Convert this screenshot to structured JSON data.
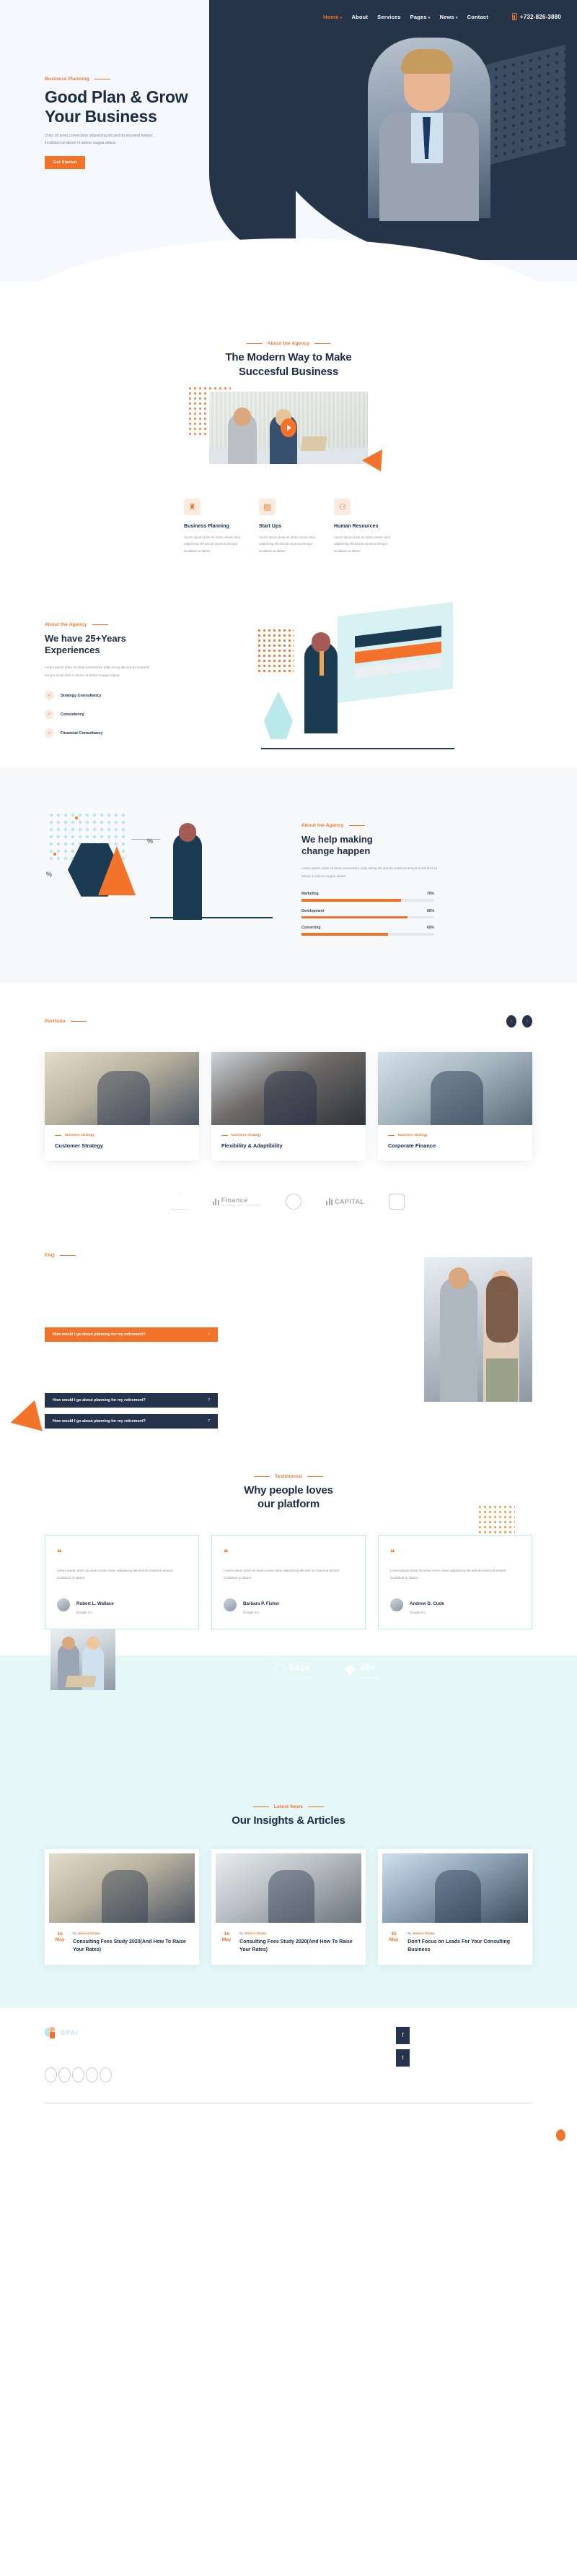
{
  "nav": {
    "items": [
      {
        "label": "Home",
        "caret": true,
        "active": true
      },
      {
        "label": "About",
        "caret": false,
        "active": false
      },
      {
        "label": "Services",
        "caret": false,
        "active": false
      },
      {
        "label": "Pages",
        "caret": true,
        "active": false
      },
      {
        "label": "News",
        "caret": true,
        "active": false
      },
      {
        "label": "Contact",
        "caret": false,
        "active": false
      }
    ],
    "phone": "+732-826-3880"
  },
  "hero": {
    "eyebrow": "Business Planning",
    "title_line1": "Good Plan & Grow",
    "title_line2": "Your Business",
    "description": "Dolor sit amet,consectetur adipisicing elit,sed do eiusmod tempor incididunt ut labore et dolore magna aliqua.",
    "cta": "Get Started"
  },
  "about": {
    "eyebrow": "About the Agency",
    "title_line1": "The Modern Way to Make",
    "title_line2": "Succesful Business",
    "play_label": "play-video"
  },
  "services": [
    {
      "icon": "chess-rook-icon",
      "title": "Business Planning",
      "desc": "Vorem ipsum dolor sit amet,consec tetur adipisicing elit,sed do eiusmod tempor incididunt ut labore"
    },
    {
      "icon": "presentation-chart-icon",
      "title": "Start Ups",
      "desc": "Vorem ipsum dolor sit amet,consec tetur adipisicing elit,sed do eiusmod tempor incididunt ut labore"
    },
    {
      "icon": "people-group-icon",
      "title": "Human Resources",
      "desc": "Vorem ipsum dolor sit amet,consec tetur adipisicing elit,sed do eiusmod tempor incididunt ut labore"
    }
  ],
  "experience": {
    "eyebrow": "About the Agency",
    "title_line1": "We have 25+Years",
    "title_line2": "Experiences",
    "desc": "Lorem ipsum dolor sit amet,consectetur adipi sicing elit,sed do eiusmod tempor incidi dunt ut labore et dolore magna aliqua.",
    "checks": [
      {
        "label": "Strategy Consultancy"
      },
      {
        "label": "Consistency"
      },
      {
        "label": "Financial Consultancy"
      }
    ]
  },
  "change": {
    "eyebrow": "About the Agency",
    "title_line1": "We help making",
    "title_line2": "change happen",
    "desc": "Lorem ipsum dolor sit amet,consectetur adipi sicing elit,sed do eiusmod tempor incidi dunt ut labore et dolore magna aliqua.",
    "pct_badge_1": "%",
    "pct_badge_2": "%",
    "skills": [
      {
        "label": "Marketing",
        "value": 75,
        "value_text": "75%"
      },
      {
        "label": "Development",
        "value": 80,
        "value_text": "80%"
      },
      {
        "label": "Converting",
        "value": 65,
        "value_text": "65%"
      }
    ]
  },
  "portfolio": {
    "eyebrow": "Portfolio",
    "prev": "‹",
    "next": "›",
    "items": [
      {
        "tag": "business strategy",
        "title": "Customer Strategy"
      },
      {
        "tag": "business strategy",
        "title": "Flexibility & Adaptibility"
      },
      {
        "tag": "business strategy",
        "title": "Corporate Finance"
      }
    ]
  },
  "brands": [
    {
      "name": "",
      "sub": ""
    },
    {
      "name": "Finance",
      "sub": "strategy and planning"
    },
    {
      "name": "",
      "sub": ""
    },
    {
      "name": "CAPITAL",
      "sub": ""
    },
    {
      "name": "",
      "sub": ""
    }
  ],
  "faq": {
    "eyebrow": "FAQ",
    "items": [
      {
        "question": "How would I go about planning for my retirement?",
        "state": "open",
        "mark": "?"
      },
      {
        "question": "How would I go about planning for my retirement?",
        "state": "closed",
        "mark": "?"
      },
      {
        "question": "How would I go about planning for my retirement?",
        "state": "closed",
        "mark": "?"
      }
    ]
  },
  "testimonial": {
    "eyebrow": "Testimonial",
    "title_line1": "Why people loves",
    "title_line2": "our platform",
    "items": [
      {
        "quote": "❝",
        "text": "Lorem ipsum dolor sit amet,conse ctetur adipisicing elit,sed do eiusmod tempor incididunt ut labore",
        "name": "Robert L. Wallace",
        "role": "Doogle Inc."
      },
      {
        "quote": "❝",
        "text": "Lorem ipsum dolor sit amet,conse ctetur adipisicing elit,sed do eiusmod tempor incididunt ut labore",
        "name": "Barbara P. Fisher",
        "role": "Doogle Inc."
      },
      {
        "quote": "❝",
        "text": "Lorem ipsum dolor sit amet,conse ctetur adipisicing elit,sed do eiusmod tempor incididunt ut labore",
        "name": "Andrew D. Cude",
        "role": "Doogle Inc."
      }
    ]
  },
  "stats": [
    {
      "icon": "mobile-icon",
      "number": "541+",
      "label": "Project Done"
    },
    {
      "icon": "diamond-icon",
      "number": "40+",
      "label": "Awards Win"
    }
  ],
  "news": {
    "eyebrow": "Latest News",
    "title": "Our Insights & Articles",
    "items": [
      {
        "day": "16",
        "month": "May",
        "by_prefix": "By",
        "author": "Jessica Ozawa",
        "title": "Consulting Fees Study 2020(And How To Raise Your Rates)"
      },
      {
        "day": "16",
        "month": "May",
        "by_prefix": "By",
        "author": "Jessica Ozawa",
        "title": "Consulting Fees Study 2020(And How To Raise Your Rates)"
      },
      {
        "day": "16",
        "month": "May",
        "by_prefix": "By",
        "author": "Jessica Ozawa",
        "title": "Don't Focus on Leads For Your Consulting Business"
      }
    ]
  },
  "footer": {
    "logo": "GPAI",
    "socials": [
      {
        "icon": "facebook-icon",
        "glyph": "f"
      },
      {
        "icon": "twitter-icon",
        "glyph": "t"
      }
    ],
    "links": [
      "",
      "",
      ""
    ],
    "to_top": "↑"
  },
  "colors": {
    "accent": "#f3732a",
    "navy": "#26334d",
    "heading": "#1d2b45",
    "mint": "#e6f7f8",
    "body_text": "#8a94a3"
  }
}
